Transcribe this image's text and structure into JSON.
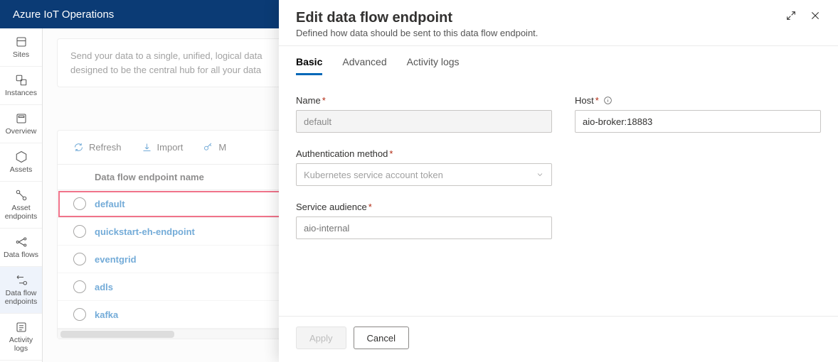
{
  "topbar": {
    "title": "Azure IoT Operations"
  },
  "rail": {
    "items": [
      {
        "label": "Sites"
      },
      {
        "label": "Instances"
      },
      {
        "label": "Overview"
      },
      {
        "label": "Assets"
      },
      {
        "label": "Asset endpoints"
      },
      {
        "label": "Data flows"
      },
      {
        "label": "Data flow endpoints"
      },
      {
        "label": "Activity logs"
      }
    ]
  },
  "info": {
    "line1": "Send your data to a single, unified, logical data",
    "line2": "designed to be the central hub for all your data"
  },
  "toolbar": {
    "refresh": "Refresh",
    "import": "Import",
    "manage": "M"
  },
  "table": {
    "header": "Data flow endpoint name",
    "rows": [
      {
        "name": "default",
        "highlight": true
      },
      {
        "name": "quickstart-eh-endpoint",
        "highlight": false
      },
      {
        "name": "eventgrid",
        "highlight": false
      },
      {
        "name": "adls",
        "highlight": false
      },
      {
        "name": "kafka",
        "highlight": false
      }
    ]
  },
  "panel": {
    "title": "Edit data flow endpoint",
    "subtitle": "Defined how data should be sent to this data flow endpoint.",
    "tabs": [
      "Basic",
      "Advanced",
      "Activity logs"
    ],
    "active_tab": "Basic",
    "fields": {
      "name_label": "Name",
      "name_value": "default",
      "host_label": "Host",
      "host_value": "aio-broker:18883",
      "auth_label": "Authentication method",
      "auth_value": "Kubernetes service account token",
      "audience_label": "Service audience",
      "audience_placeholder": "aio-internal"
    },
    "footer": {
      "apply": "Apply",
      "cancel": "Cancel"
    }
  }
}
